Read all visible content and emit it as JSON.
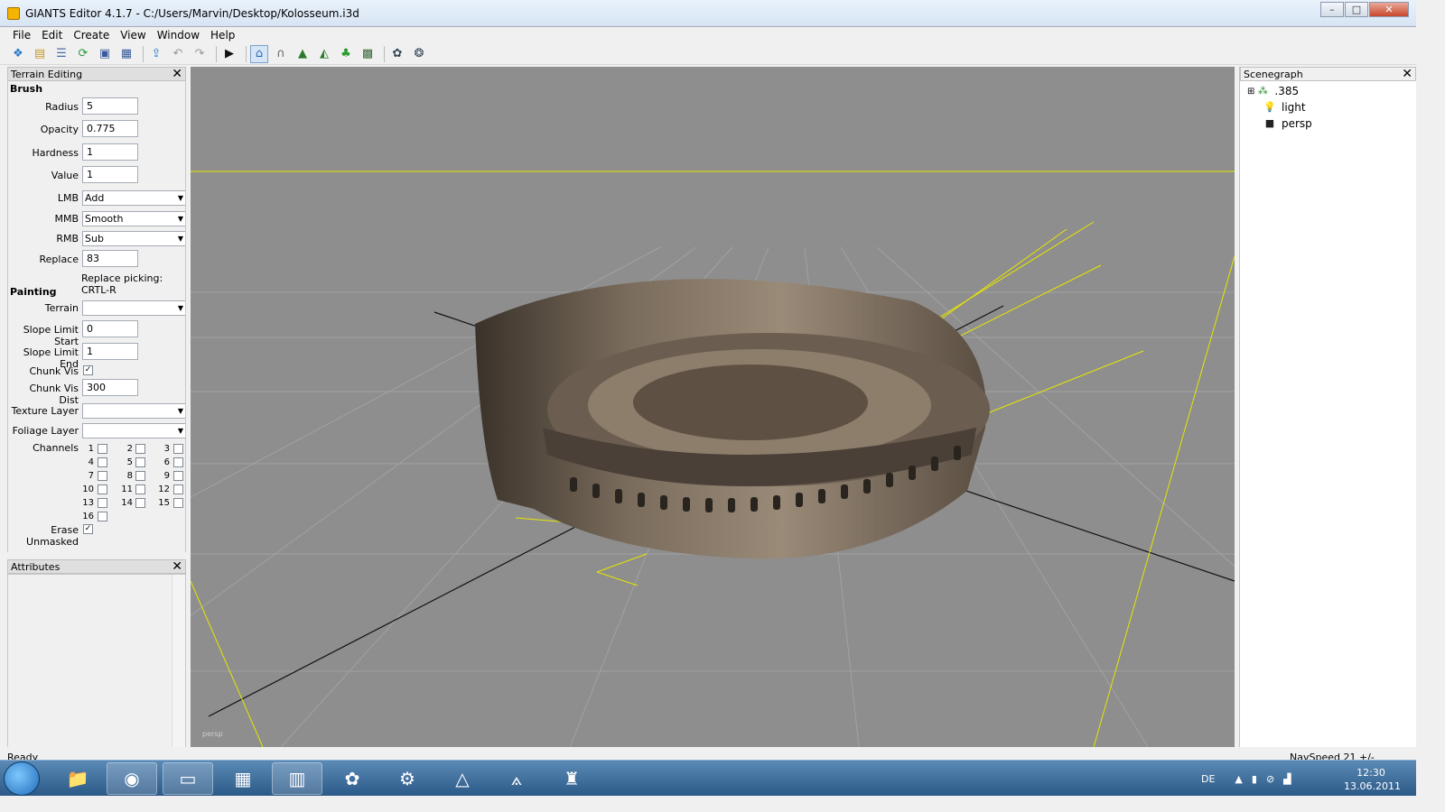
{
  "window": {
    "title": "GIANTS Editor 4.1.7 - C:/Users/Marvin/Desktop/Kolosseum.i3d",
    "min": "–",
    "max": "□",
    "close": "✕"
  },
  "menu": [
    "File",
    "Edit",
    "Create",
    "View",
    "Window",
    "Help"
  ],
  "toolbar": {
    "icons": [
      "new-icon",
      "open-icon",
      "list-icon",
      "refresh-icon",
      "save-icon",
      "save-all-icon",
      "import-icon",
      "undo-icon",
      "redo-icon",
      "play-icon",
      "terrain-icon",
      "magnet-icon",
      "terrain-paint-icon",
      "terrain-raise-icon",
      "foliage-icon",
      "texture-icon",
      "settings-icon",
      "settings-alt-icon"
    ]
  },
  "terrain_panel": {
    "title": "Terrain Editing",
    "close": "✕",
    "brush_heading": "Brush",
    "radius": {
      "label": "Radius",
      "value": "5"
    },
    "opacity": {
      "label": "Opacity",
      "value": "0.775"
    },
    "hardness": {
      "label": "Hardness",
      "value": "1"
    },
    "value": {
      "label": "Value",
      "value": "1"
    },
    "lmb": {
      "label": "LMB",
      "value": "Add"
    },
    "mmb": {
      "label": "MMB",
      "value": "Smooth"
    },
    "rmb": {
      "label": "RMB",
      "value": "Sub"
    },
    "replace": {
      "label": "Replace",
      "value": "83"
    },
    "replace_hint": "Replace picking: CRTL-R",
    "painting_heading": "Painting",
    "terrain": {
      "label": "Terrain",
      "value": ""
    },
    "slope_start": {
      "label": "Slope Limit Start",
      "value": "0"
    },
    "slope_end": {
      "label": "Slope Limit End",
      "value": "1"
    },
    "chunk_vis": {
      "label": "Chunk Vis",
      "checked": true
    },
    "chunk_vis_dist": {
      "label": "Chunk Vis Dist",
      "value": "300"
    },
    "texture_layer": {
      "label": "Texture Layer",
      "value": ""
    },
    "foliage_layer": {
      "label": "Foliage Layer",
      "value": ""
    },
    "channels_label": "Channels",
    "channels": [
      "1",
      "2",
      "3",
      "4",
      "5",
      "6",
      "7",
      "8",
      "9",
      "10",
      "11",
      "12",
      "13",
      "14",
      "15",
      "16"
    ],
    "erase_unmasked": {
      "label": "Erase Unmasked",
      "checked": true
    }
  },
  "attributes_panel": {
    "title": "Attributes",
    "close": "✕"
  },
  "viewport": {
    "camera_label": "persp"
  },
  "scenegraph": {
    "title": "Scenegraph",
    "close": "✕",
    "items": [
      {
        "label": ".385",
        "icon": "transform-group-icon",
        "expander": "⊞"
      },
      {
        "label": "light",
        "icon": "light-bulb-icon"
      },
      {
        "label": "persp",
        "icon": "camera-icon"
      }
    ]
  },
  "status": {
    "left": "Ready",
    "right": "NavSpeed 21 +/-"
  },
  "taskbar": {
    "apps": [
      "explorer-icon",
      "firefox-icon",
      "giants-editor-icon",
      "calendar-icon",
      "winrar-icon",
      "icq-icon",
      "tractor-icon",
      "assassin-icon",
      "assassin-logo-icon",
      "game-icon"
    ],
    "language": "DE",
    "clock_time": "12:30",
    "clock_date": "13.06.2011"
  }
}
